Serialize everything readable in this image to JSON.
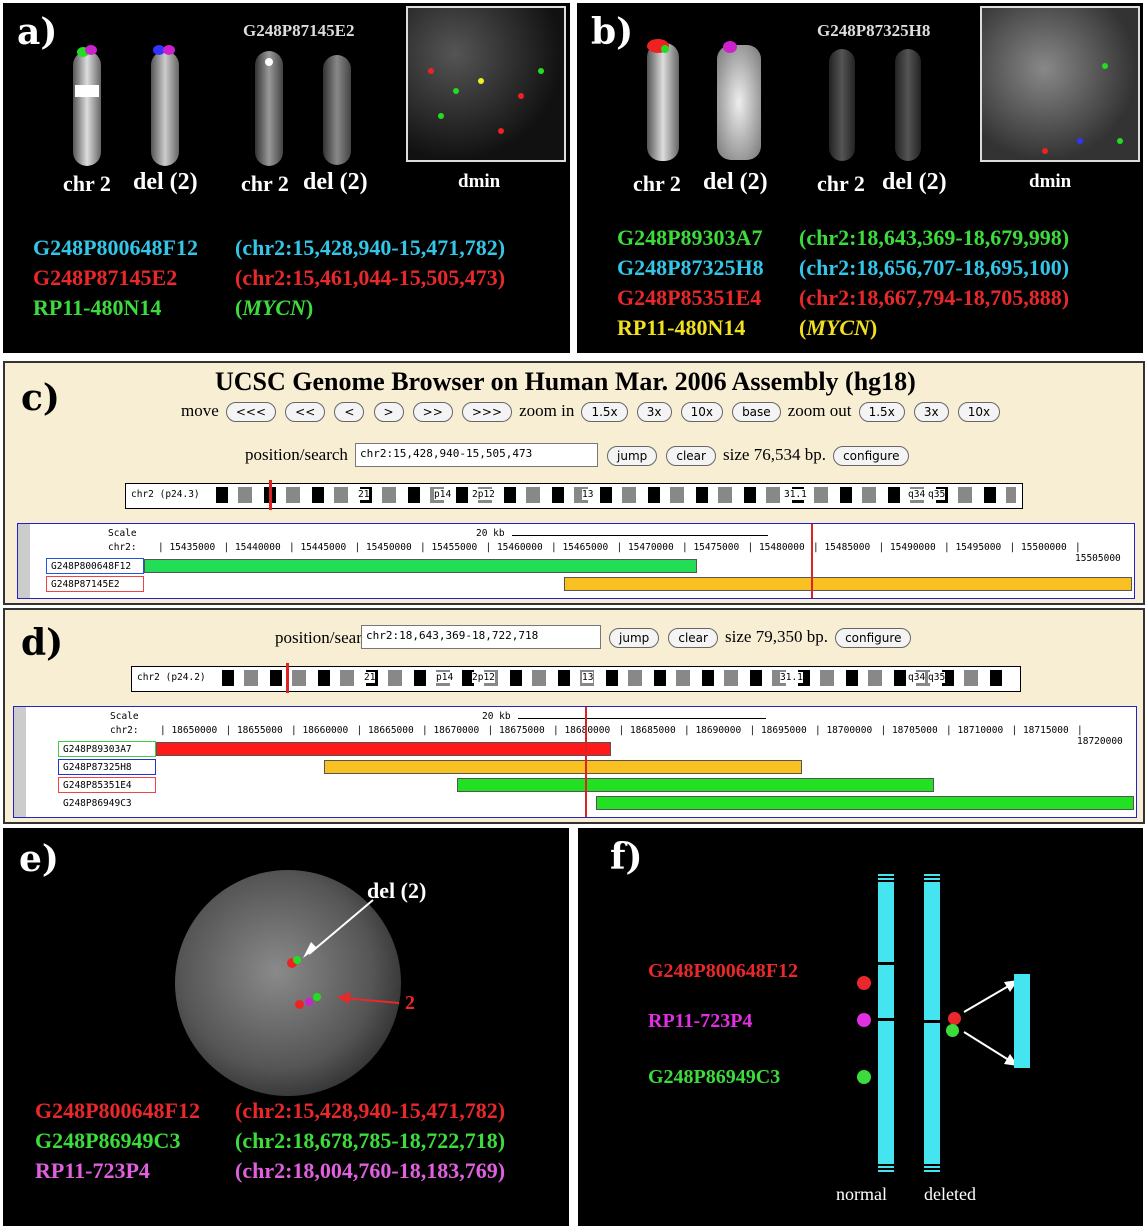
{
  "panel_a": {
    "label": "a)",
    "probe_title": "G248P87145E2",
    "chrom_labels": [
      "chr 2",
      "del (2)",
      "chr 2",
      "del (2)",
      "dmin"
    ],
    "legend": [
      {
        "name": "G248P800648F12",
        "coord": "(chr2:15,428,940-15,471,782)",
        "color": "#33c6e8"
      },
      {
        "name": "G248P87145E2",
        "coord": "(chr2:15,461,044-15,505,473)",
        "color": "#e8282a"
      },
      {
        "name": "RP11-480N14",
        "coord_prefix": "(",
        "coord_italic": "MYCN",
        "coord_suffix": ")",
        "color": "#3cdc3c"
      }
    ]
  },
  "panel_b": {
    "label": "b)",
    "probe_title": "G248P87325H8",
    "chrom_labels": [
      "chr 2",
      "del (2)",
      "chr 2",
      "del (2)",
      "dmin"
    ],
    "legend": [
      {
        "name": "G248P89303A7",
        "coord": "(chr2:18,643,369-18,679,998)",
        "color": "#3cdc3c"
      },
      {
        "name": "G248P87325H8",
        "coord": "(chr2:18,656,707-18,695,100)",
        "color": "#33c6e8"
      },
      {
        "name": "G248P85351E4",
        "coord": "(chr2:18,667,794-18,705,888)",
        "color": "#e8282a"
      },
      {
        "name": "RP11-480N14",
        "coord_prefix": "(",
        "coord_italic": "MYCN",
        "coord_suffix": ")",
        "color": "#f0e020"
      }
    ]
  },
  "panel_c": {
    "label": "c)",
    "title": "UCSC Genome Browser on Human Mar. 2006 Assembly (hg18)",
    "move_label": "move",
    "move_buttons": [
      "<<<",
      "<<",
      "<",
      ">",
      ">>",
      ">>>"
    ],
    "zoom_in_label": "zoom in",
    "zoom_in_buttons": [
      "1.5x",
      "3x",
      "10x",
      "base"
    ],
    "zoom_out_label": "zoom out",
    "zoom_out_buttons": [
      "1.5x",
      "3x",
      "10x"
    ],
    "position_label": "position/search",
    "position_value": "chr2:15,428,940-15,505,473",
    "jump": "jump",
    "clear": "clear",
    "size_text": "size 76,534 bp.",
    "configure": "configure",
    "ideogram_label": "chr2 (p24.3)",
    "ideogram_bands": [
      "21",
      "p14",
      "2p12",
      "13",
      "31.1",
      "q34",
      "q35"
    ],
    "scale_label": "Scale",
    "chr_label": "chr2:",
    "scale_bar": "20 kb",
    "ticks": [
      "15435000",
      "15440000",
      "15445000",
      "15450000",
      "15455000",
      "15460000",
      "15465000",
      "15470000",
      "15475000",
      "15480000",
      "15485000",
      "15490000",
      "15495000",
      "15500000",
      "15505000"
    ],
    "tracks": [
      {
        "name": "G248P800648F12",
        "color": "#22dd55",
        "border": "#2255dd"
      },
      {
        "name": "G248P87145E2",
        "color": "#f8c020",
        "border": "#ee4444"
      }
    ]
  },
  "panel_d": {
    "label": "d)",
    "position_label": "position/search",
    "position_value": "chr2:18,643,369-18,722,718",
    "jump": "jump",
    "clear": "clear",
    "size_text": "size 79,350 bp.",
    "configure": "configure",
    "ideogram_label": "chr2 (p24.2)",
    "ideogram_bands": [
      "21",
      "p14",
      "2p12",
      "13",
      "31.1",
      "q34",
      "q35"
    ],
    "scale_label": "Scale",
    "chr_label": "chr2:",
    "scale_bar": "20 kb",
    "ticks": [
      "18650000",
      "18655000",
      "18660000",
      "18665000",
      "18670000",
      "18675000",
      "18680000",
      "18685000",
      "18690000",
      "18695000",
      "18700000",
      "18705000",
      "18710000",
      "18715000",
      "18720000"
    ],
    "tracks": [
      {
        "name": "G248P89303A7",
        "color": "#ff1a1a",
        "border": "#44cc44"
      },
      {
        "name": "G248P87325H8",
        "color": "#f8c020",
        "border": "#2233cc"
      },
      {
        "name": "G248P85351E4",
        "color": "#22e022",
        "border": "#ee4444"
      },
      {
        "name": "G248P86949C3",
        "color": "#22e022",
        "border": "#ffffff"
      }
    ]
  },
  "panel_e": {
    "label": "e)",
    "del_label": "del (2)",
    "normal_label": "2",
    "legend": [
      {
        "name": "G248P800648F12",
        "coord": "(chr2:15,428,940-15,471,782)",
        "color": "#e8282a"
      },
      {
        "name": "G248P86949C3",
        "coord": "(chr2:18,678,785-18,722,718)",
        "color": "#3cdc3c"
      },
      {
        "name": "RP11-723P4",
        "coord": "(chr2:18,004,760-18,183,769)",
        "color": "#e060e0"
      }
    ]
  },
  "panel_f": {
    "label": "f)",
    "probes": [
      {
        "name": "G248P800648F12",
        "color": "#e8282a"
      },
      {
        "name": "RP11-723P4",
        "color": "#e030e0"
      },
      {
        "name": "G248P86949C3",
        "color": "#3cdc3c"
      }
    ],
    "normal_label": "normal",
    "deleted_label": "deleted",
    "chrom_color": "#44e4f0"
  }
}
